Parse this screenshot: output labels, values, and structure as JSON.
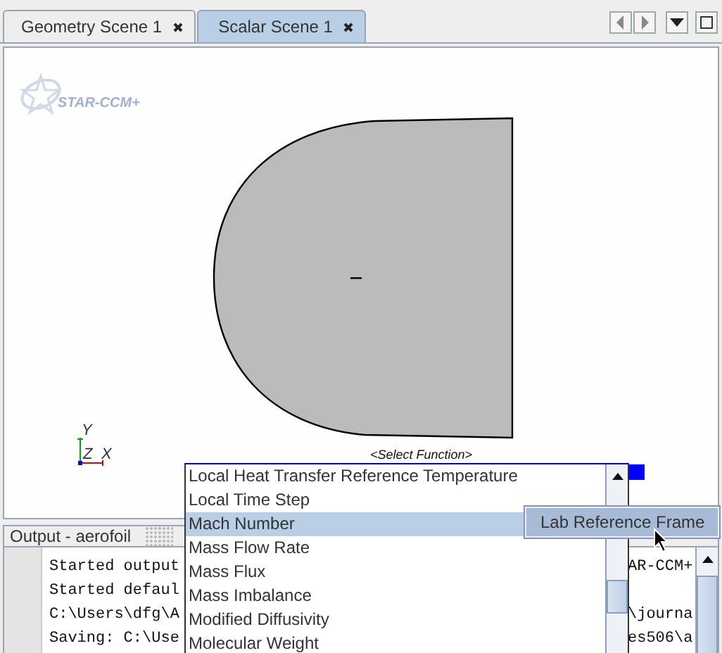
{
  "tabs": [
    {
      "label": "Geometry Scene 1",
      "selected": false
    },
    {
      "label": "Scalar Scene 1",
      "selected": true
    }
  ],
  "scene": {
    "logo": "STAR-CCM+",
    "function_label": "<Select Function>",
    "axes": {
      "y": "Y",
      "z": "Z",
      "x": "X"
    }
  },
  "output": {
    "title": "Output - aerofoil",
    "lines": [
      {
        "left": "Started output",
        "right": "AR-CCM+"
      },
      {
        "left": "Started defaul"
      },
      {
        "left": "C:\\Users\\dfg\\A",
        "right": "\\journa"
      },
      {
        "left": "Saving: C:\\Use",
        "right": "es506\\a"
      }
    ]
  },
  "function_list": {
    "items": [
      {
        "label": "Local Heat Transfer Reference Temperature",
        "selected": false
      },
      {
        "label": "Local Time Step",
        "selected": false
      },
      {
        "label": "Mach Number",
        "selected": true
      },
      {
        "label": "Mass Flow Rate",
        "selected": false
      },
      {
        "label": "Mass Flux",
        "selected": false
      },
      {
        "label": "Mass Imbalance",
        "selected": false
      },
      {
        "label": "Modified Diffusivity",
        "selected": false
      },
      {
        "label": "Molecular Weight",
        "selected": false
      }
    ]
  },
  "submenu": {
    "items": [
      {
        "label": "Lab Reference Frame",
        "selected": true
      }
    ]
  }
}
